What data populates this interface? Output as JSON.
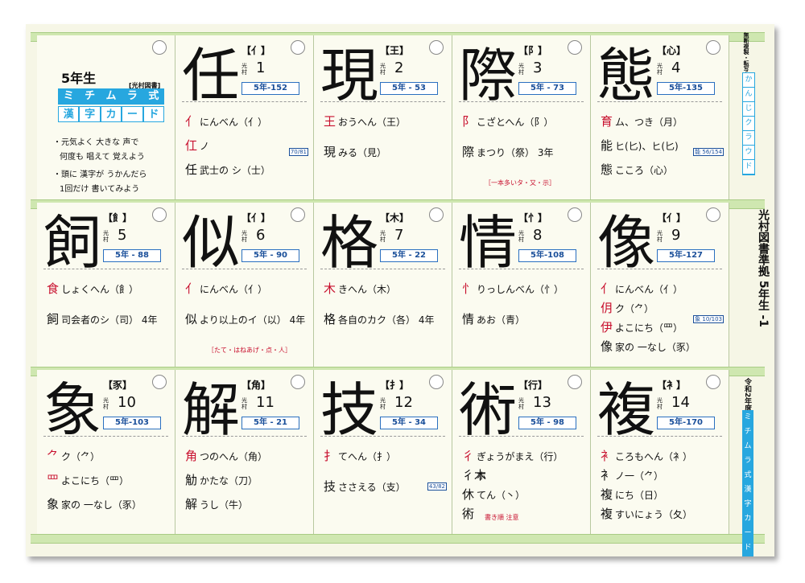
{
  "title_card": {
    "grade": "5年生",
    "publisher_tag": "[光村図書]",
    "brand_top": [
      "ミ",
      "チ",
      "ム",
      "ラ",
      "式"
    ],
    "brand_bottom": [
      "漢",
      "字",
      "カ",
      "ー",
      "ド"
    ],
    "tips": [
      "・元気よく 大きな 声で",
      "何度も 唱えて 覚えよう",
      "・頭に 漢字が うかんだら",
      "1回だけ 書いてみよう"
    ]
  },
  "cards": [
    {
      "kanji": "任",
      "radical": "【亻】",
      "pub": "光村",
      "num": "1",
      "ref": "5年-152",
      "lines": [
        {
          "c": "亻",
          "t": "にんべん（亻）"
        },
        {
          "c": "仜",
          "t": "ノ"
        },
        {
          "c": "任",
          "t": "武士の シ（士）",
          "blk": true
        }
      ],
      "extra": "70/81"
    },
    {
      "kanji": "現",
      "radical": "【王】",
      "pub": "光村",
      "num": "2",
      "ref": "5年 - 53",
      "lines": [
        {
          "c": "王",
          "t": "おうへん（王）"
        },
        {
          "c": "現",
          "t": "みる（見）",
          "blk": true
        }
      ]
    },
    {
      "kanji": "際",
      "radical": "【阝】",
      "pub": "光村",
      "num": "3",
      "ref": "5年 - 73",
      "lines": [
        {
          "c": "阝",
          "t": "こざとへん（阝）"
        },
        {
          "c": "際",
          "t": "まつり（祭） 3年",
          "blk": true
        }
      ],
      "note": "［一本多いタ・又・示］"
    },
    {
      "kanji": "態",
      "radical": "【心】",
      "pub": "光村",
      "num": "4",
      "ref": "5年-135",
      "lines": [
        {
          "c": "育",
          "t": "ム、つき（月）"
        },
        {
          "c": "能",
          "t": "ヒ(匕)、ヒ(匕)",
          "blk": true
        },
        {
          "c": "態",
          "t": "こころ（心）",
          "blk": true
        }
      ],
      "extra": "能 56/154"
    },
    {
      "kanji": "飼",
      "radical": "【飠】",
      "pub": "光村",
      "num": "5",
      "ref": "5年 - 88",
      "lines": [
        {
          "c": "食",
          "t": "しょくへん（飠）"
        },
        {
          "c": "飼",
          "t": "司会者のシ（司） 4年",
          "blk": true
        }
      ]
    },
    {
      "kanji": "似",
      "radical": "【亻】",
      "pub": "光村",
      "num": "6",
      "ref": "5年 - 90",
      "lines": [
        {
          "c": "亻",
          "t": "にんべん（亻）"
        },
        {
          "c": "似",
          "t": "より以上のイ（以） 4年",
          "blk": true
        }
      ],
      "note": "［たて・はねあげ・点・人］"
    },
    {
      "kanji": "格",
      "radical": "【木】",
      "pub": "光村",
      "num": "7",
      "ref": "5年 - 22",
      "lines": [
        {
          "c": "木",
          "t": "きへん（木）"
        },
        {
          "c": "格",
          "t": "各自のカク（各） 4年",
          "blk": true
        }
      ]
    },
    {
      "kanji": "情",
      "radical": "【忄】",
      "pub": "光村",
      "num": "8",
      "ref": "5年-108",
      "lines": [
        {
          "c": "忄",
          "t": "りっしんべん（忄）"
        },
        {
          "c": "情",
          "t": "あお（青）",
          "blk": true
        }
      ]
    },
    {
      "kanji": "像",
      "radical": "【亻】",
      "pub": "光村",
      "num": "9",
      "ref": "5年-127",
      "lines": [
        {
          "c": "亻",
          "t": "にんべん（亻）"
        },
        {
          "c": "仴",
          "t": "ク（⺈）"
        },
        {
          "c": "伊",
          "t": "よこにち（罒）"
        },
        {
          "c": "像",
          "t": "家の 一なし（豕）",
          "blk": true
        }
      ],
      "extra": "象 10/103"
    },
    {
      "kanji": "象",
      "radical": "【豕】",
      "pub": "光村",
      "num": "10",
      "ref": "5年-103",
      "lines": [
        {
          "c": "⺈",
          "t": "ク（⺈）"
        },
        {
          "c": "罒",
          "t": "よこにち（罒）"
        },
        {
          "c": "象",
          "t": "家の 一なし（豕）",
          "blk": true
        }
      ]
    },
    {
      "kanji": "解",
      "radical": "【角】",
      "pub": "光村",
      "num": "11",
      "ref": "5年 - 21",
      "lines": [
        {
          "c": "角",
          "t": "つのへん（角）"
        },
        {
          "c": "觔",
          "t": "かたな（刀）",
          "blk": true
        },
        {
          "c": "解",
          "t": "うし（牛）",
          "blk": true
        }
      ]
    },
    {
      "kanji": "技",
      "radical": "【扌】",
      "pub": "光村",
      "num": "12",
      "ref": "5年 - 34",
      "lines": [
        {
          "c": "扌",
          "t": "てへん（扌）"
        },
        {
          "c": "技",
          "t": "ささえる（支）",
          "blk": true
        }
      ],
      "extra": "43/82"
    },
    {
      "kanji": "術",
      "radical": "【行】",
      "pub": "光村",
      "num": "13",
      "ref": "5年 - 98",
      "lines": [
        {
          "c": "彳",
          "t": "ぎょうがまえ（行）"
        },
        {
          "c": "彳木",
          "t": "ホ",
          "blk": true
        },
        {
          "c": "休",
          "t": "てん（丶）",
          "blk": true
        },
        {
          "c": "術",
          "t": "",
          "blk": true
        }
      ],
      "note": "書き順 注意"
    },
    {
      "kanji": "複",
      "radical": "【衤】",
      "pub": "光村",
      "num": "14",
      "ref": "5年-170",
      "lines": [
        {
          "c": "衤",
          "t": "ころもへん（衤）"
        },
        {
          "c": "衤",
          "t": "ノ一（⺈）",
          "blk": true
        },
        {
          "c": "複",
          "t": "にち（日）",
          "blk": true
        },
        {
          "c": "複",
          "t": "すいにょう（夂）",
          "blk": true
        }
      ]
    }
  ],
  "side": {
    "title": "光村図書準拠 5年生 -1",
    "edition": "令和2年度版",
    "top_note": "無断複製・転写を禁ず",
    "top_brand": [
      "か",
      "ん",
      "じ",
      "ク",
      "ラ",
      "ウ",
      "ド"
    ],
    "bottom_brand": [
      "ミ",
      "チ",
      "ム",
      "ラ",
      "式",
      "漢",
      "字",
      "カ",
      "ー",
      "ド"
    ]
  }
}
